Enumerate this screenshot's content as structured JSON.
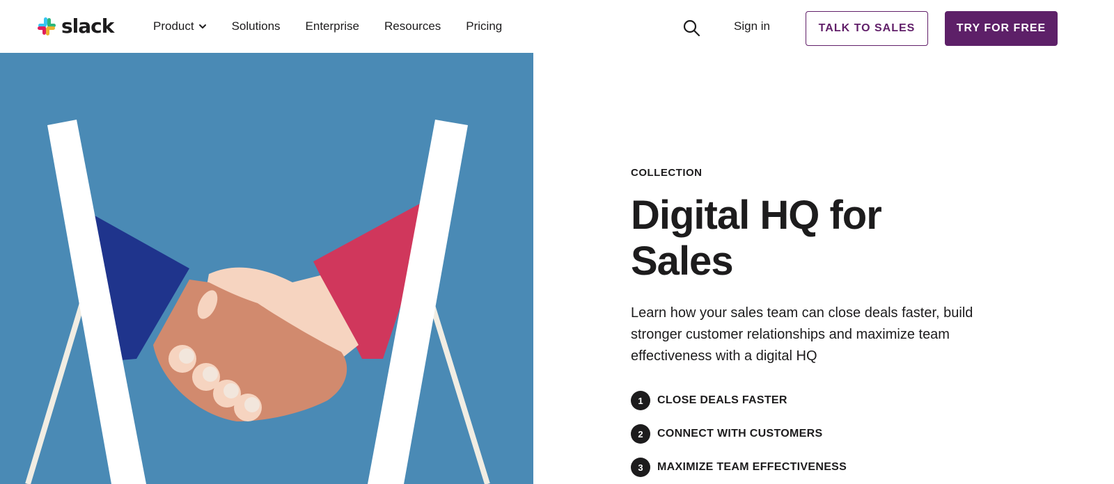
{
  "brand": {
    "name": "slack"
  },
  "nav": {
    "items": [
      {
        "label": "Product",
        "has_dropdown": true
      },
      {
        "label": "Solutions"
      },
      {
        "label": "Enterprise"
      },
      {
        "label": "Resources"
      },
      {
        "label": "Pricing"
      }
    ],
    "search_icon": "search-icon",
    "sign_in": "Sign in",
    "talk_to_sales": "TALK TO SALES",
    "try_for_free": "TRY FOR FREE"
  },
  "hero": {
    "eyebrow": "COLLECTION",
    "title": "Digital HQ for Sales",
    "description": "Learn how your sales team can close deals faster, build stronger customer relationships and maximize team effectiveness with a digital HQ",
    "steps": [
      {
        "number": "1",
        "label": "CLOSE DEALS FASTER"
      },
      {
        "number": "2",
        "label": "CONNECT WITH CUSTOMERS"
      },
      {
        "number": "3",
        "label": "MAXIMIZE TEAM EFFECTIVENESS"
      }
    ]
  },
  "colors": {
    "brand_purple": "#5d2068",
    "hero_blue": "#4a8ab5",
    "sleeve_navy": "#1f348c",
    "sleeve_red": "#d0375c"
  }
}
